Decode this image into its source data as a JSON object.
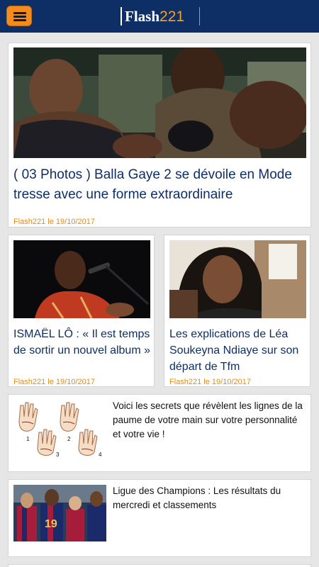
{
  "header": {
    "logo_part1": "Flash",
    "logo_part2": "221"
  },
  "articles": [
    {
      "title": "( 03 Photos ) Balla Gaye 2 se dévoile en Mode tresse avec une forme extraordinaire",
      "date": "Flash221 le 19/10/2017",
      "image": "wrestler-training-photo"
    },
    {
      "title": "ISMAËL LÔ : « Il est temps de sortir un nouvel album »",
      "date": "Flash221 le 19/10/2017",
      "image": "singer-on-stage-photo"
    },
    {
      "title": "Les explications de Léa Soukeyna Ndiaye sur son départ de Tfm",
      "date": "Flash221 le 19/10/2017",
      "image": "woman-selfie-photo"
    },
    {
      "title": "Voici les secrets que révèlent les lignes de la paume de votre main sur votre personnalité et votre vie !",
      "image": "palm-lines-drawing",
      "palm_numbers": [
        "1",
        "2",
        "3",
        "4"
      ]
    },
    {
      "title": "Ligue des Champions : Les résultats du mercredi et classements",
      "image": "football-players-photo"
    }
  ],
  "colors": {
    "header_bg": "#0d2f66",
    "menu_button": "#f28c1e",
    "accent": "#f7a21b",
    "title_text": "#0d2f66",
    "date_text": "#e08b1a",
    "page_bg": "#e6e6e6"
  }
}
